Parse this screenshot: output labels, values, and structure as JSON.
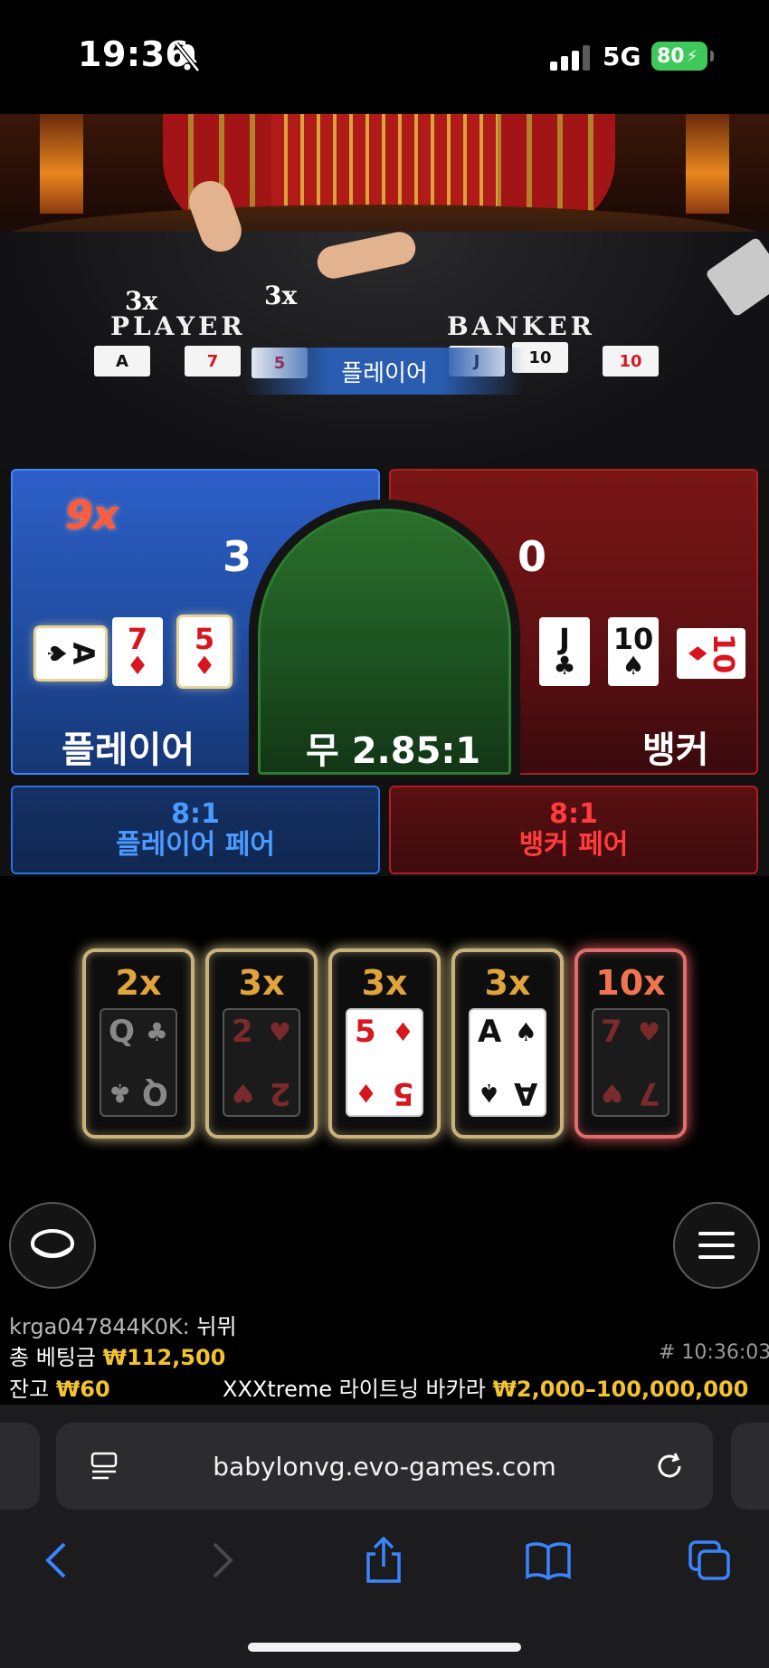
{
  "status_bar": {
    "time": "19:36",
    "network": "5G",
    "battery": "80"
  },
  "table_video": {
    "player_mult_1": "3x",
    "player_mult_2": "3x",
    "player_word": "PLAYER",
    "banker_word": "BANKER",
    "result_banner": "플레이어",
    "player_cards": [
      "A",
      "7",
      "5"
    ],
    "banker_cards": [
      "J",
      "10",
      "10"
    ]
  },
  "bets": {
    "player": {
      "bonus_multiplier": "9x",
      "score": "3",
      "label": "플레이어",
      "cards": [
        {
          "rank": "A",
          "suit": "♠",
          "color": "black",
          "rotated": true,
          "highlighted": true
        },
        {
          "rank": "7",
          "suit": "♦",
          "color": "red",
          "rotated": false,
          "highlighted": false
        },
        {
          "rank": "5",
          "suit": "♦",
          "color": "red",
          "rotated": false,
          "highlighted": true
        }
      ]
    },
    "tie": {
      "label": "무 2.85:1"
    },
    "banker": {
      "score": "0",
      "label": "뱅커",
      "cards": [
        {
          "rank": "J",
          "suit": "♣",
          "color": "black",
          "rotated": false
        },
        {
          "rank": "10",
          "suit": "♠",
          "color": "black",
          "rotated": false
        },
        {
          "rank": "10",
          "suit": "♦",
          "color": "red",
          "rotated": true
        }
      ]
    },
    "player_pair": {
      "odds": "8:1",
      "label": "플레이어 페어"
    },
    "banker_pair": {
      "odds": "8:1",
      "label": "뱅커 페어"
    }
  },
  "lightning_cards": [
    {
      "multiplier": "2x",
      "rank": "Q",
      "suit": "♣",
      "lit": false,
      "red": false
    },
    {
      "multiplier": "3x",
      "rank": "2",
      "suit": "♥",
      "lit": false,
      "red": true
    },
    {
      "multiplier": "3x",
      "rank": "5",
      "suit": "♦",
      "lit": true,
      "red": true
    },
    {
      "multiplier": "3x",
      "rank": "A",
      "suit": "♠",
      "lit": true,
      "red": false
    },
    {
      "multiplier": "10x",
      "rank": "7",
      "suit": "♥",
      "lit": false,
      "red": true
    }
  ],
  "info": {
    "chat_user": "krga047844K0K:",
    "chat_message": "뉘뮈",
    "total_bet_label": "총 베팅금",
    "total_bet_value": "₩112,500",
    "round_id": "# 10:36:03",
    "balance_label": "잔고",
    "balance_value": "₩60",
    "game_name": "XXXtreme 라이트닝 바카라",
    "bet_limits": "₩2,000–100,000,000"
  },
  "browser": {
    "url": "babylonvg.evo-games.com"
  },
  "colors": {
    "player": "#2d5fc8",
    "banker": "#7a1516",
    "tie": "#2a6f2b",
    "gold": "#f2c230"
  }
}
